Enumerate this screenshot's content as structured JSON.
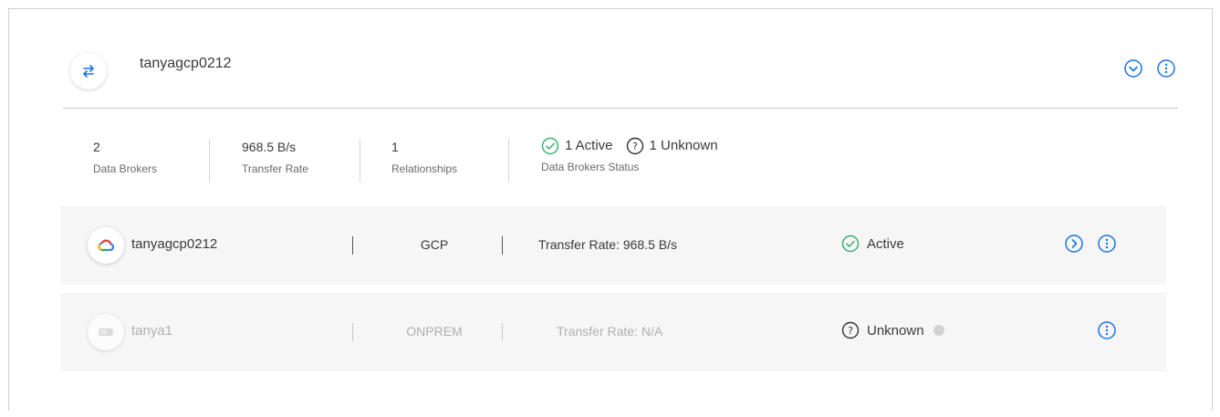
{
  "group": {
    "name": "tanyagcp0212",
    "icon": "transfer-arrows-icon"
  },
  "stats": {
    "data_brokers": {
      "value": "2",
      "label": "Data Brokers"
    },
    "transfer_rate": {
      "value": "968.5 B/s",
      "label": "Transfer Rate"
    },
    "relationships": {
      "value": "1",
      "label": "Relationships"
    },
    "status": {
      "active_text": "1 Active",
      "unknown_text": "1 Unknown",
      "label": "Data Brokers Status"
    }
  },
  "brokers": [
    {
      "name": "tanyagcp0212",
      "type": "GCP",
      "transfer_rate": "Transfer Rate: 968.5 B/s",
      "status": "Active",
      "icon": "google-cloud-icon"
    },
    {
      "name": "tanya1",
      "type": "ONPREM",
      "transfer_rate": "Transfer Rate: N/A",
      "status": "Unknown",
      "icon": "server-icon"
    }
  ],
  "colors": {
    "accent_blue": "#1a73e8",
    "active_green": "#3cb371",
    "muted_gray": "#b0b0b0"
  }
}
